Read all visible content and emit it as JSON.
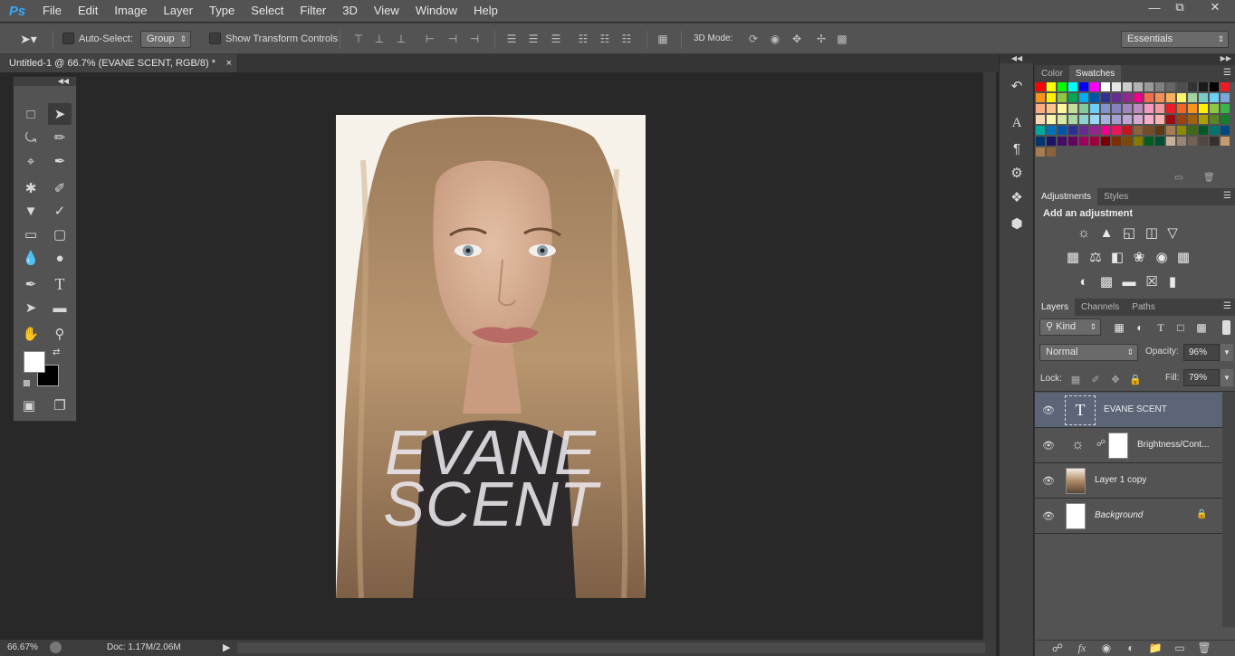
{
  "app": {
    "logo": "Ps"
  },
  "menu": [
    "File",
    "Edit",
    "Image",
    "Layer",
    "Type",
    "Select",
    "Filter",
    "3D",
    "View",
    "Window",
    "Help"
  ],
  "window_controls": {
    "minimize": "—",
    "restore": "⧉",
    "close": "✕"
  },
  "options": {
    "auto_select_label": "Auto-Select:",
    "auto_select_value": "Group",
    "show_transform_label": "Show Transform Controls",
    "mode3d_label": "3D Mode:",
    "workspace": "Essentials"
  },
  "document": {
    "tab_title": "Untitled-1 @ 66.7% (EVANE SCENT, RGB/8) *",
    "text_line1": "EVANE",
    "text_line2": "SCENT"
  },
  "status": {
    "zoom": "66.67%",
    "doc": "Doc: 1.17M/2.06M"
  },
  "color_panel": {
    "tabs": [
      "Color",
      "Swatches"
    ],
    "active": "Swatches"
  },
  "adjust_panel": {
    "tabs": [
      "Adjustments",
      "Styles"
    ],
    "heading": "Add an adjustment"
  },
  "layers_panel": {
    "tabs": [
      "Layers",
      "Channels",
      "Paths"
    ],
    "kind": "Kind",
    "blend_mode": "Normal",
    "opacity_label": "Opacity:",
    "opacity": "96%",
    "lock_label": "Lock:",
    "fill_label": "Fill:",
    "fill": "79%",
    "layers": [
      {
        "name": "EVANE SCENT",
        "type": "text",
        "selected": true
      },
      {
        "name": "Brightness/Cont...",
        "type": "adjustment"
      },
      {
        "name": "Layer 1 copy",
        "type": "image"
      },
      {
        "name": "Background",
        "type": "background",
        "locked": true
      }
    ]
  },
  "swatch_rows": [
    [
      "#ff0000",
      "#ffff00",
      "#00ff00",
      "#00ffff",
      "#0000ff",
      "#ff00ff",
      "#ffffff",
      "#e6e6e6",
      "#cccccc",
      "#b3b3b3",
      "#999999",
      "#808080",
      "#666666",
      "#4d4d4d",
      "#333333",
      "#1a1a1a",
      "#000000",
      "#ed1c24"
    ],
    [
      "#f7941d",
      "#fff200",
      "#8dc63f",
      "#00a651",
      "#00aeef",
      "#0054a6",
      "#2e3192",
      "#662d91",
      "#92278f",
      "#ec008c",
      "#f26c4f",
      "#f68e56",
      "#fbaf5d",
      "#fff568",
      "#a3d39c",
      "#7accc8",
      "#6dcff6",
      "#7da7d9"
    ],
    [
      "#f9ad81",
      "#fdc689",
      "#fff799",
      "#c4df9b",
      "#82ca9c",
      "#6ecff6",
      "#8393ca",
      "#8781bd",
      "#a186be",
      "#bd8cbf",
      "#f49ac1",
      "#f5989d",
      "#ed1c24",
      "#f26522",
      "#f7941d",
      "#fff200",
      "#8dc63f",
      "#39b54a"
    ],
    [
      "#fbd6b3",
      "#fff9ae",
      "#d7e8a5",
      "#a8d8a6",
      "#8fd3d0",
      "#97d9f7",
      "#a6b4dc",
      "#a49fd0",
      "#bea6d3",
      "#d6a9d0",
      "#f6aec9",
      "#f7b4b0",
      "#9e0b0f",
      "#a0410d",
      "#a3620a",
      "#aba000",
      "#598527",
      "#197b30"
    ],
    [
      "#00a99d",
      "#0072bc",
      "#0054a6",
      "#2e3192",
      "#662d91",
      "#92278f",
      "#ec008c",
      "#ed145b",
      "#c4141c",
      "#8c6239",
      "#754c24",
      "#603913",
      "#a67c52",
      "#8b8b00",
      "#406618",
      "#005826",
      "#00746b",
      "#004a80"
    ],
    [
      "#003471",
      "#1b1464",
      "#440e62",
      "#630460",
      "#9e005d",
      "#9e0039",
      "#790000",
      "#7b2e00",
      "#7d4900",
      "#827b00",
      "#005e20",
      "#004d2f",
      "#c7b299",
      "#998675",
      "#736357",
      "#534741",
      "#362f2d",
      "#c69c6d"
    ],
    [
      "#a67c52",
      "#8c6239"
    ]
  ]
}
